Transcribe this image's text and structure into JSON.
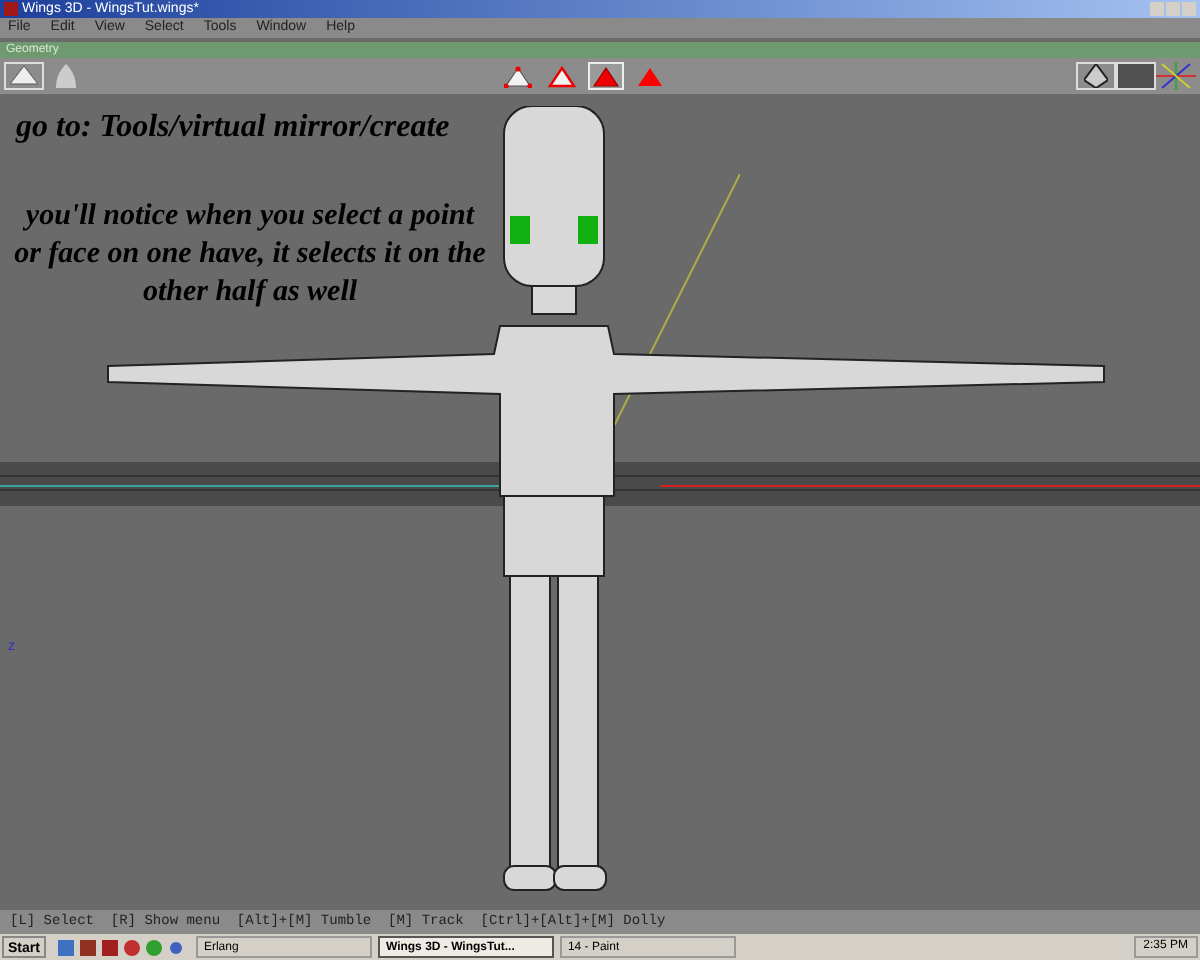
{
  "window": {
    "title": "Wings 3D - WingsTut.wings*"
  },
  "menu": [
    "File",
    "Edit",
    "View",
    "Select",
    "Tools",
    "Window",
    "Help"
  ],
  "geometry_bar": {
    "title": "Geometry"
  },
  "select_modes": [
    {
      "kind": "vertex",
      "selected": false
    },
    {
      "kind": "edge",
      "selected": false
    },
    {
      "kind": "face",
      "selected": true
    },
    {
      "kind": "body",
      "selected": false
    }
  ],
  "annotations": [
    "go to: Tools/virtual mirror/create",
    "you'll notice when you select a point or face on one have, it selects it on the other half as well"
  ],
  "axis_label": "z",
  "status_line": "[L] Select  [R] Show menu  [Alt]+[M] Tumble  [M] Track  [Ctrl]+[Alt]+[M] Dolly",
  "taskbar": {
    "start": "Start",
    "tasks": [
      {
        "label": "Erlang",
        "selected": false
      },
      {
        "label": "Wings 3D - WingsTut...",
        "selected": true
      },
      {
        "label": "14 - Paint",
        "selected": false
      }
    ],
    "clock": "2:35 PM"
  }
}
